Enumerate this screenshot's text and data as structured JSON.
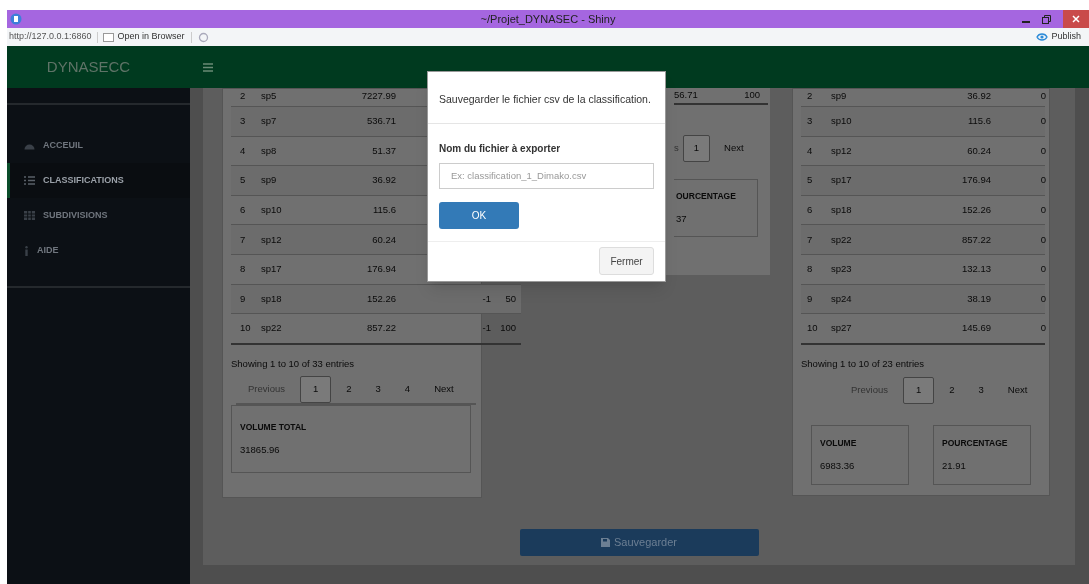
{
  "window": {
    "title": "~/Projet_DYNASEC - Shiny"
  },
  "address_bar": {
    "url": "http://127.0.0.1:6860",
    "open_in_browser": "Open in Browser",
    "publish": "Publish"
  },
  "header": {
    "brand": "DYNASECC"
  },
  "sidebar": {
    "items": [
      {
        "label": "ACCEUIL",
        "selected": false
      },
      {
        "label": "CLASSIFICATIONS",
        "selected": true
      },
      {
        "label": "SUBDIVISIONS",
        "selected": false
      },
      {
        "label": "AIDE",
        "selected": false
      }
    ]
  },
  "left_table": {
    "rows": [
      {
        "cells": [
          "2",
          "sp5",
          "7227.99"
        ]
      },
      {
        "cells": [
          "3",
          "sp7",
          "536.71"
        ]
      },
      {
        "cells": [
          "4",
          "sp8",
          "51.37"
        ]
      },
      {
        "cells": [
          "5",
          "sp9",
          "36.92"
        ]
      },
      {
        "cells": [
          "6",
          "sp10",
          "115.6"
        ]
      },
      {
        "cells": [
          "7",
          "sp12",
          "60.24"
        ]
      },
      {
        "cells": [
          "8",
          "sp17",
          "176.94"
        ]
      },
      {
        "cells": [
          "9",
          "sp18",
          "152.26",
          "-1",
          "50"
        ]
      },
      {
        "cells": [
          "10",
          "sp22",
          "857.22",
          "-1",
          "100"
        ]
      }
    ],
    "info": "Showing 1 to 10 of 33 entries",
    "pagination": [
      {
        "label": "Previous",
        "selected": false,
        "disabled": true
      },
      {
        "label": "1",
        "selected": true,
        "disabled": false
      },
      {
        "label": "2",
        "selected": false,
        "disabled": false
      },
      {
        "label": "3",
        "selected": false,
        "disabled": false
      },
      {
        "label": "4",
        "selected": false,
        "disabled": false
      },
      {
        "label": "Next",
        "selected": false,
        "disabled": false
      }
    ],
    "stats": [
      {
        "label": "VOLUME TOTAL",
        "value": "31865.96"
      }
    ]
  },
  "middle_table": {
    "rows": [
      {
        "cells": [
          "56.71",
          "100"
        ]
      }
    ],
    "pagination": [
      {
        "label": "s",
        "selected": false,
        "disabled": true
      },
      {
        "label": "1",
        "selected": true,
        "disabled": false
      },
      {
        "label": "Next",
        "selected": false,
        "disabled": false
      }
    ],
    "stats": [
      {
        "label": "OURCENTAGE",
        "value": "37"
      }
    ]
  },
  "right_table": {
    "rows": [
      {
        "cells": [
          "2",
          "sp9",
          "36.92",
          "0"
        ]
      },
      {
        "cells": [
          "3",
          "sp10",
          "115.6",
          "0"
        ]
      },
      {
        "cells": [
          "4",
          "sp12",
          "60.24",
          "0"
        ]
      },
      {
        "cells": [
          "5",
          "sp17",
          "176.94",
          "0"
        ]
      },
      {
        "cells": [
          "6",
          "sp18",
          "152.26",
          "0"
        ]
      },
      {
        "cells": [
          "7",
          "sp22",
          "857.22",
          "0"
        ]
      },
      {
        "cells": [
          "8",
          "sp23",
          "132.13",
          "0"
        ]
      },
      {
        "cells": [
          "9",
          "sp24",
          "38.19",
          "0"
        ]
      },
      {
        "cells": [
          "10",
          "sp27",
          "145.69",
          "0"
        ]
      }
    ],
    "info": "Showing 1 to 10 of 23 entries",
    "pagination": [
      {
        "label": "Previous",
        "selected": false,
        "disabled": true
      },
      {
        "label": "1",
        "selected": true,
        "disabled": false
      },
      {
        "label": "2",
        "selected": false,
        "disabled": false
      },
      {
        "label": "3",
        "selected": false,
        "disabled": false
      },
      {
        "label": "Next",
        "selected": false,
        "disabled": false
      }
    ],
    "stats": [
      {
        "label": "VOLUME",
        "value": "6983.36"
      },
      {
        "label": "POURCENTAGE",
        "value": "21.91"
      }
    ]
  },
  "save_button": "Sauvegarder",
  "modal": {
    "title": "Sauvegarder le fichier csv de la classification.",
    "field_label": "Nom du fichier à exporter",
    "placeholder": "Ex: classification_1_Dimako.csv",
    "ok": "OK",
    "close": "Fermer"
  }
}
